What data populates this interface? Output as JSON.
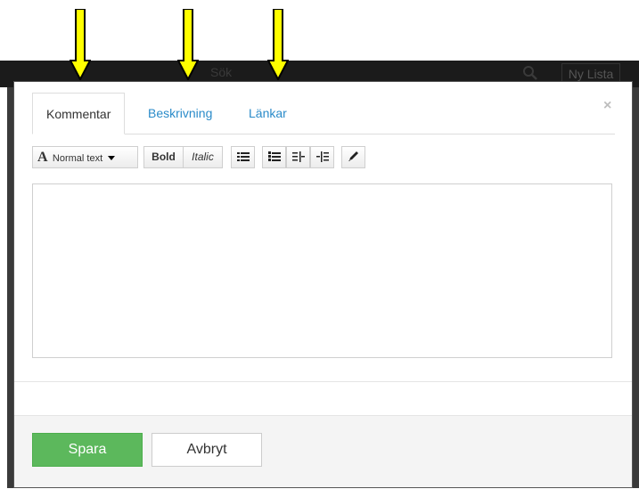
{
  "background": {
    "search_text": "Sök",
    "new_list_label": "Ny Lista"
  },
  "modal": {
    "close_glyph": "×",
    "tabs": [
      {
        "label": "Kommentar",
        "active": true
      },
      {
        "label": "Beskrivning",
        "active": false
      },
      {
        "label": "Länkar",
        "active": false
      }
    ],
    "toolbar": {
      "font_glyph": "A",
      "style_label": "Normal text",
      "bold_label": "Bold",
      "italic_label": "Italic",
      "icons": [
        "unordered-list-icon",
        "ordered-list-icon",
        "outdent-icon",
        "indent-icon",
        "pencil-icon"
      ]
    },
    "editor_value": "",
    "footer": {
      "save_label": "Spara",
      "cancel_label": "Avbryt"
    }
  },
  "colors": {
    "arrow_fill": "#ffff00",
    "save_green": "#5cb85c",
    "tab_link": "#2a8bc9"
  }
}
